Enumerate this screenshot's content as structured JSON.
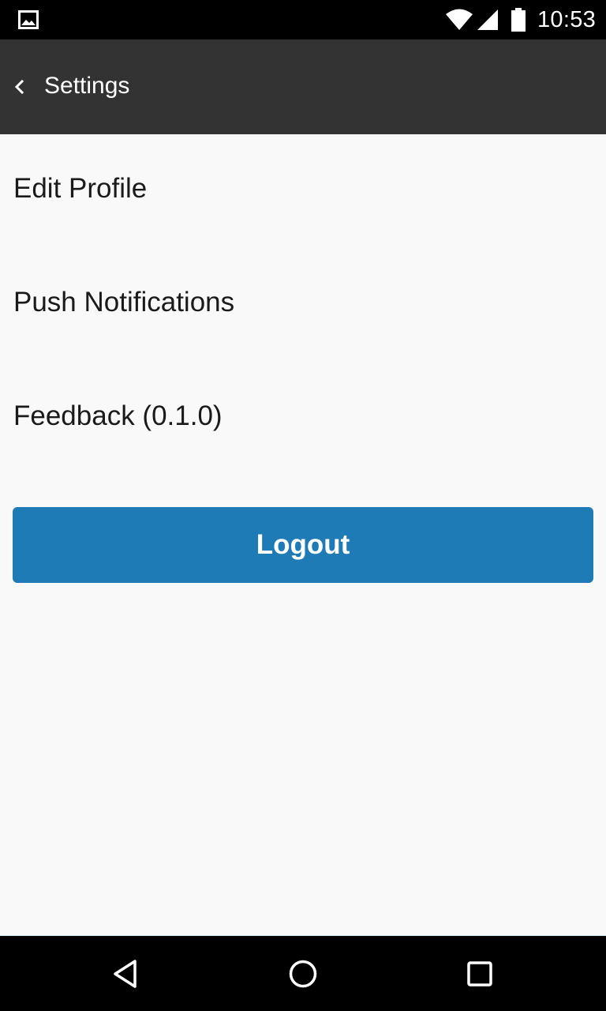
{
  "status_bar": {
    "time": "10:53",
    "icons": [
      "image-notification-icon",
      "wifi-icon",
      "signal-icon",
      "battery-icon"
    ]
  },
  "app_bar": {
    "title": "Settings",
    "back_icon": "chevron-left-icon",
    "background": "#333333"
  },
  "menu": {
    "items": [
      {
        "label": "Edit Profile"
      },
      {
        "label": "Push Notifications"
      },
      {
        "label": "Feedback (0.1.0)"
      }
    ]
  },
  "logout": {
    "label": "Logout",
    "color": "#1f7bb5"
  },
  "nav_bar": {
    "icons": [
      "back-triangle-icon",
      "home-circle-icon",
      "recents-square-icon"
    ]
  }
}
